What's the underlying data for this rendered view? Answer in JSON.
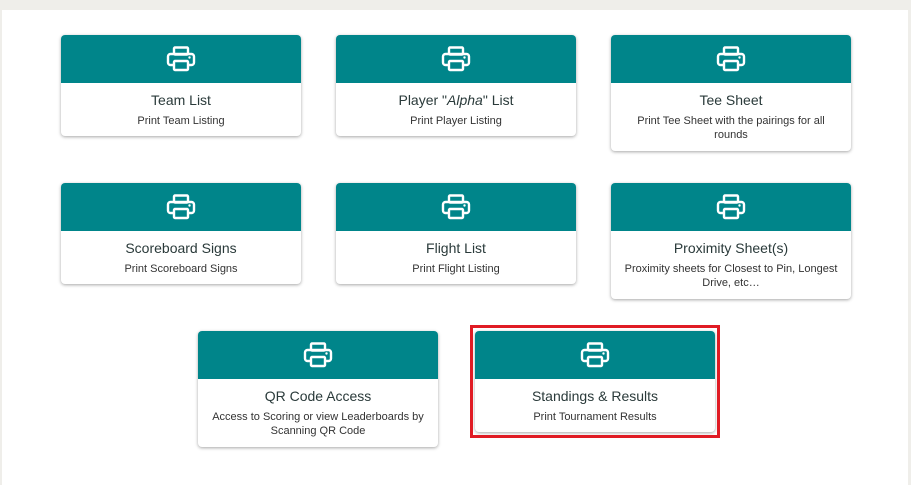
{
  "cards": [
    {
      "title": "Team List",
      "desc": "Print Team Listing",
      "icon": "printer-icon"
    },
    {
      "title_pre": "Player \"",
      "title_em": "Alpha",
      "title_post": "\" List",
      "desc": "Print Player Listing",
      "icon": "printer-icon"
    },
    {
      "title": "Tee Sheet",
      "desc": "Print Tee Sheet with the pairings for all rounds",
      "icon": "printer-icon"
    },
    {
      "title": "Scoreboard Signs",
      "desc": "Print Scoreboard Signs",
      "icon": "printer-icon"
    },
    {
      "title": "Flight List",
      "desc": "Print Flight Listing",
      "icon": "printer-icon"
    },
    {
      "title": "Proximity Sheet(s)",
      "desc": "Proximity sheets for Closest to Pin, Longest Drive, etc…",
      "icon": "printer-icon"
    },
    {
      "title": "QR Code Access",
      "desc": "Access to Scoring or view Leaderboards by Scanning QR Code",
      "icon": "printer-icon"
    },
    {
      "title": "Standings & Results",
      "desc": "Print Tournament Results",
      "icon": "printer-icon"
    }
  ],
  "colors": {
    "header": "#00858a",
    "highlight": "#e01b24"
  }
}
